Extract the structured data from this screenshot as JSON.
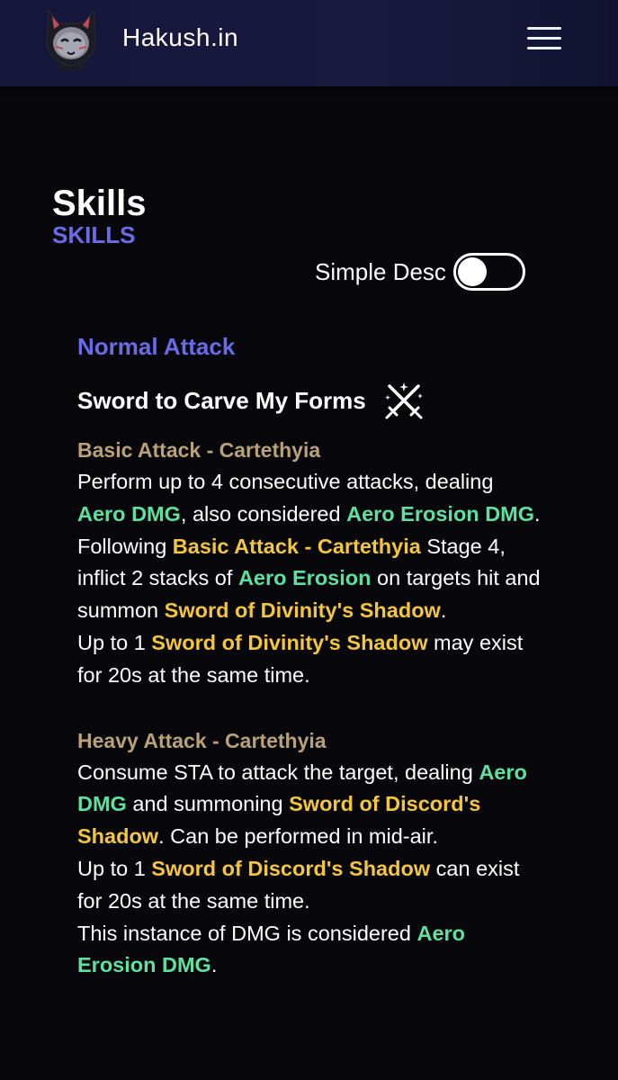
{
  "header": {
    "site_name": "Hakush.in",
    "logo_icon": "kitsune-mask-logo-icon",
    "menu_icon": "hamburger-menu-icon"
  },
  "section": {
    "title": "Skills",
    "subtitle": "SKILLS"
  },
  "toggle": {
    "label": "Simple Desc",
    "state": "off"
  },
  "skill": {
    "type": "Normal Attack",
    "name": "Sword to Carve My Forms",
    "icon": "crossed-swords-icon",
    "basic": {
      "heading": "Basic Attack - Cartethyia",
      "p1": [
        "Perform up to 4 consecutive attacks, dealing ",
        "Aero DMG",
        ", also considered ",
        "Aero Erosion DMG",
        "."
      ],
      "p2": [
        "Following ",
        "Basic Attack - Cartethyia",
        " Stage 4, inflict 2 stacks of ",
        "Aero Erosion",
        " on targets hit and summon ",
        "Sword of Divinity's Shadow",
        "."
      ],
      "p3": [
        "Up to 1 ",
        "Sword of Divinity's Shadow",
        " may exist for 20s at the same time."
      ]
    },
    "heavy": {
      "heading": "Heavy Attack - Cartethyia",
      "p1": [
        "Consume STA to attack the target, dealing ",
        "Aero DMG",
        " and summoning ",
        "Sword of Discord's Shadow",
        ". Can be performed in mid-air."
      ],
      "p2": [
        "Up to 1 ",
        "Sword of Discord's Shadow",
        " can exist for 20s at the same time."
      ],
      "p3": [
        "This instance of DMG is considered ",
        "Aero Erosion DMG",
        "."
      ]
    }
  },
  "colors": {
    "accent": "#6b6be8",
    "aero": "#5ee0a0",
    "highlight": "#f3c63d",
    "subheading": "#b9a278",
    "background": "#07070c",
    "header": "#16163a"
  }
}
